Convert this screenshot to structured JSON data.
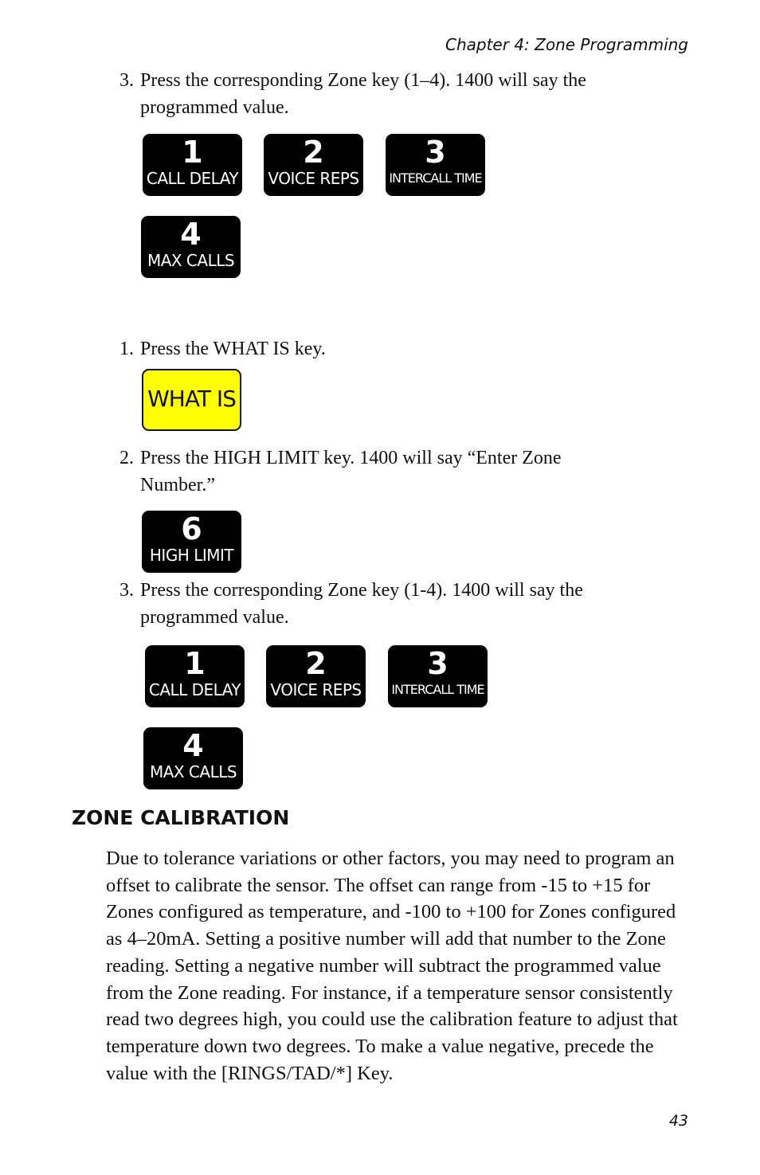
{
  "header": {
    "chapter": "Chapter 4: Zone Programming"
  },
  "block1": {
    "step": {
      "num": "3.",
      "line1": "Press the corresponding Zone key (1–4). 1400 will say the",
      "line2": "programmed value."
    },
    "keys": [
      {
        "digit": "1",
        "label": "CALL DELAY"
      },
      {
        "digit": "2",
        "label": "VOICE REPS"
      },
      {
        "digit": "3",
        "label": "INTERCALL TIME"
      },
      {
        "digit": "4",
        "label": "MAX CALLS"
      }
    ]
  },
  "block2": {
    "step1": {
      "num": "1.",
      "line1": "Press the WHAT IS key."
    },
    "what_is_key": {
      "label": "WHAT IS",
      "color": "#ffff00"
    },
    "step2": {
      "num": "2.",
      "line1": "Press the HIGH LIMIT key.  1400 will say “Enter Zone",
      "line2": "Number.”"
    },
    "high_limit_key": {
      "digit": "6",
      "label": "HIGH LIMIT"
    },
    "step3": {
      "num": "3.",
      "line1": "Press the corresponding Zone key (1-4). 1400 will say the",
      "line2": "programmed value."
    },
    "keys": [
      {
        "digit": "1",
        "label": "CALL DELAY"
      },
      {
        "digit": "2",
        "label": "VOICE REPS"
      },
      {
        "digit": "3",
        "label": "INTERCALL TIME"
      },
      {
        "digit": "4",
        "label": "MAX CALLS"
      }
    ]
  },
  "section": {
    "title": "ZONE CALIBRATION",
    "paragraph": "Due to tolerance variations or other factors, you may need to program an offset to calibrate the sensor. The offset can range from -15 to +15 for Zones configured as temperature, and -100 to +100 for Zones configured as 4–20mA. Setting a positive number will add that number to the Zone reading. Setting a negative number will subtract the programmed value from the Zone reading. For instance, if a temperature sensor consistently read two degrees high, you could use the calibration feature to adjust that temperature down two degrees.  To make a value negative, precede the value with the [RINGS/TAD/*] Key."
  },
  "footer": {
    "page_number": "43"
  }
}
